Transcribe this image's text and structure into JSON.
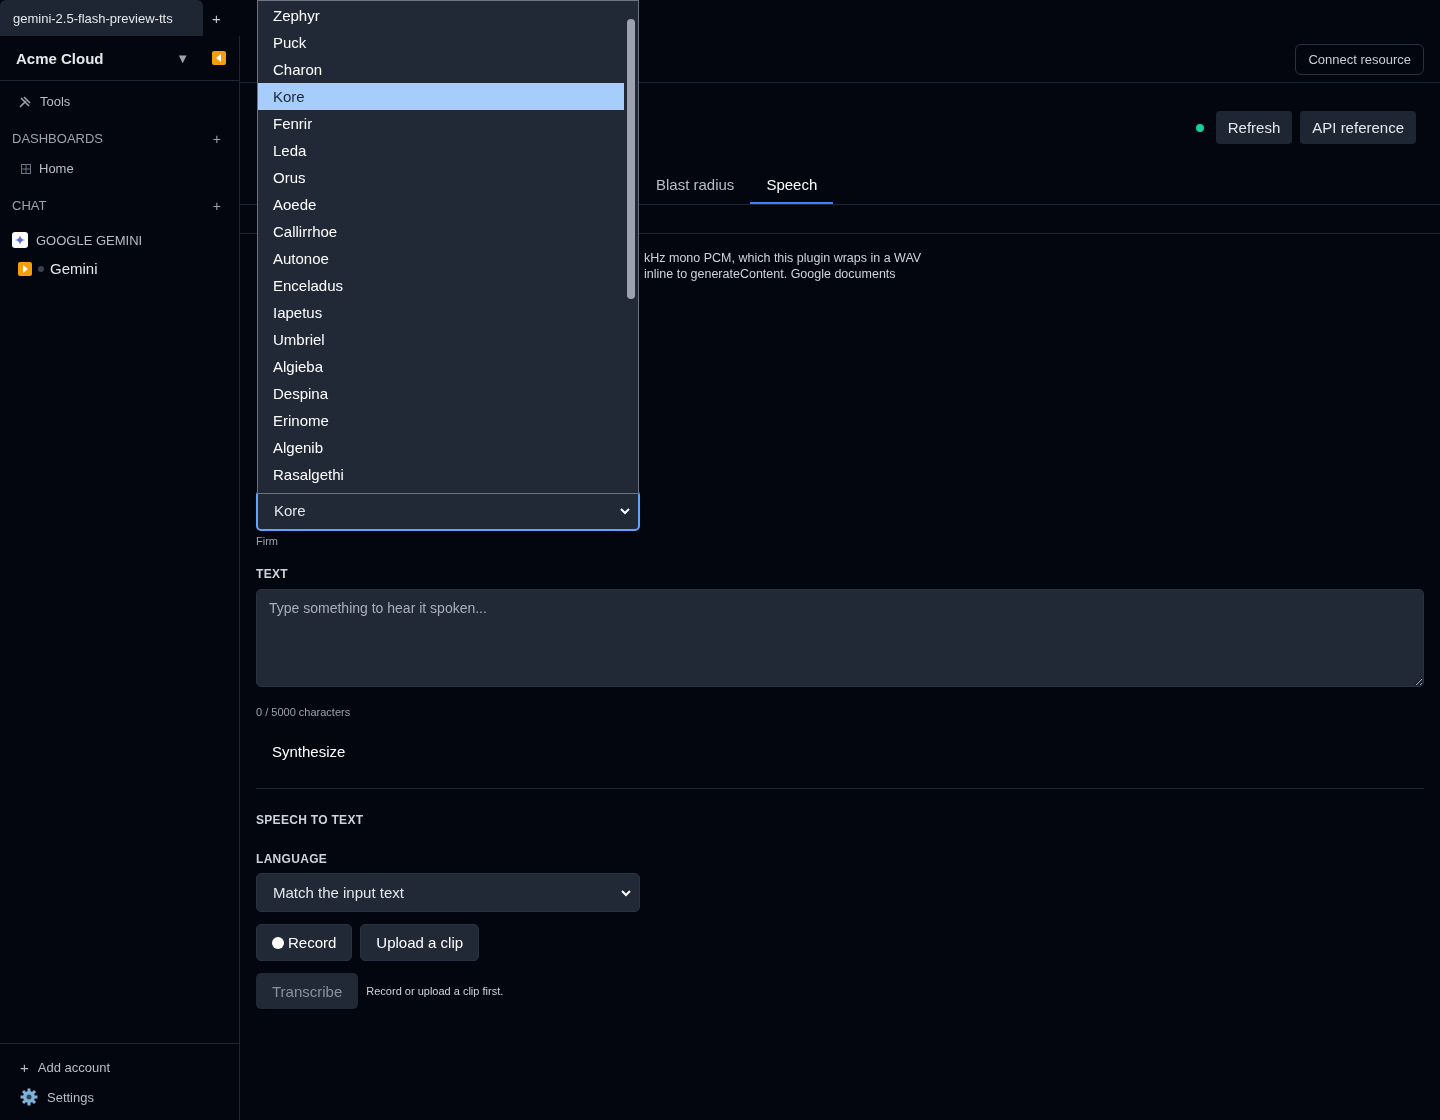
{
  "tab_bar": {
    "tabs": [
      {
        "label": "gemini-2.5-flash-preview-tts",
        "selected": true
      }
    ],
    "new_tab": "+"
  },
  "sidebar": {
    "workspace": "Acme Cloud",
    "workspace_caret": "▼",
    "nav": [
      {
        "label": "Tools"
      }
    ],
    "sections": [
      {
        "title": "DASHBOARDS",
        "add": "+",
        "items": [
          {
            "label": "Home",
            "kind": "dashboard"
          }
        ]
      },
      {
        "title": "CHAT",
        "add": "+",
        "items": [
          {
            "label": "GOOGLE GEMINI",
            "kind": "provider"
          },
          {
            "label": "Gemini",
            "kind": "chat"
          }
        ]
      }
    ],
    "footer": {
      "add_icon": "+",
      "add_account": "Add account",
      "settings": "Settings"
    }
  },
  "header": {
    "connect_button": "Connect resource"
  },
  "toolbar": {
    "online": true,
    "buttons": [
      "Refresh",
      "API reference"
    ]
  },
  "tabs": [
    {
      "label": "Blast radius",
      "selected": false
    },
    {
      "label": "Speech",
      "selected": true
    }
  ],
  "description_lines": [
    "kHz mono PCM, which this plugin wraps in a WAV",
    "inline to generateContent. Google documents"
  ],
  "voice": {
    "value": "Kore",
    "focused": true,
    "hint": "Firm",
    "options": [
      {
        "label": "Zephyr",
        "selected": false
      },
      {
        "label": "Puck",
        "selected": false
      },
      {
        "label": "Charon",
        "selected": false
      },
      {
        "label": "Kore",
        "selected": true
      },
      {
        "label": "Fenrir",
        "selected": false
      },
      {
        "label": "Leda",
        "selected": false
      },
      {
        "label": "Orus",
        "selected": false
      },
      {
        "label": "Aoede",
        "selected": false
      },
      {
        "label": "Callirrhoe",
        "selected": false
      },
      {
        "label": "Autonoe",
        "selected": false
      },
      {
        "label": "Enceladus",
        "selected": false
      },
      {
        "label": "Iapetus",
        "selected": false
      },
      {
        "label": "Umbriel",
        "selected": false
      },
      {
        "label": "Algieba",
        "selected": false
      },
      {
        "label": "Despina",
        "selected": false
      },
      {
        "label": "Erinome",
        "selected": false
      },
      {
        "label": "Algenib",
        "selected": false
      },
      {
        "label": "Rasalgethi",
        "selected": false
      }
    ]
  },
  "text_section": {
    "label": "TEXT",
    "placeholder": "Type something to hear it spoken...",
    "counter": "0 / 5000 characters",
    "synthesize": "Synthesize"
  },
  "speech_to_text": {
    "title": "SPEECH TO TEXT",
    "language_label": "LANGUAGE",
    "language": "Match the input text",
    "record": "Record",
    "upload": "Upload a clip",
    "transcribe": {
      "label": "Transcribe",
      "disabled": true
    },
    "hint": "Record or upload a clip first."
  }
}
